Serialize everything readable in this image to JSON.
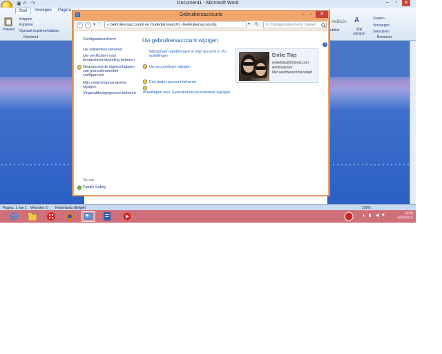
{
  "word": {
    "window_title": "Document1 - Microsoft Word",
    "tabs": [
      "Start",
      "Invoegen",
      "Pagina"
    ],
    "ribbon": {
      "paste_label": "Plakken",
      "cut_label": "Knippen",
      "copy_label": "Kopiëren",
      "format_painter_label": "Opmaak kopiëren/plakken",
      "clipboard_group": "Klembord",
      "style_preview": "AaBbCc",
      "subtitle_label": "ubtitel",
      "change_styles_label": "Stijl wijzigen",
      "find_label": "Zoeken",
      "replace_label": "Vervangen",
      "select_label": "Selecteren",
      "editing_group": "Bewerken"
    },
    "status": {
      "page": "Pagina: 1 van 1",
      "words": "Woorden: 0",
      "language": "Nederlands (België)",
      "zoom": "100%"
    }
  },
  "control_panel": {
    "window_title": "Gebruikersaccounts",
    "breadcrumb": "« Gebruikersaccounts en Ouderlijk toezicht  ›  Gebruikersaccounts",
    "search_placeholder": "In Configuratiescherm zoeken",
    "sidebar": {
      "home": "Configuratiescherm",
      "links": [
        "Uw referenties beheren",
        "Uw certificaten voor bestandsversleuteling beheren",
        "Geavanceerde eigenschappen van gebruikersprofiel configureren",
        "Mijn omgevingsvariabelen wijzigen",
        "Vingerafdrukgegevens beheren"
      ],
      "see_also": "Zie ook",
      "family_safety": "Family Safety"
    },
    "main": {
      "heading": "Uw gebruikersaccount wijzigen",
      "links": [
        "Wijzigingen aanbrengen in mijn account in Pc-instellingen",
        "Uw accounttype wijzigen",
        "Een ander account beheren",
        "Instellingen voor Gebruikersaccountbeheer wijzigen"
      ]
    },
    "user": {
      "name": "Emilie Thijs",
      "email": "emilethijs@hotmail.com",
      "role": "Administrator",
      "password_status": "Met wachtwoord beveiligd"
    }
  },
  "taskbar": {
    "time": "19:08",
    "date": "6/06/2013"
  },
  "colors": {
    "window_frame": "#f2a56b",
    "taskbar": "#cf6f79",
    "link": "#1f64c0",
    "heading": "#1e5eab",
    "desktop_blue": "#2b64b8"
  }
}
